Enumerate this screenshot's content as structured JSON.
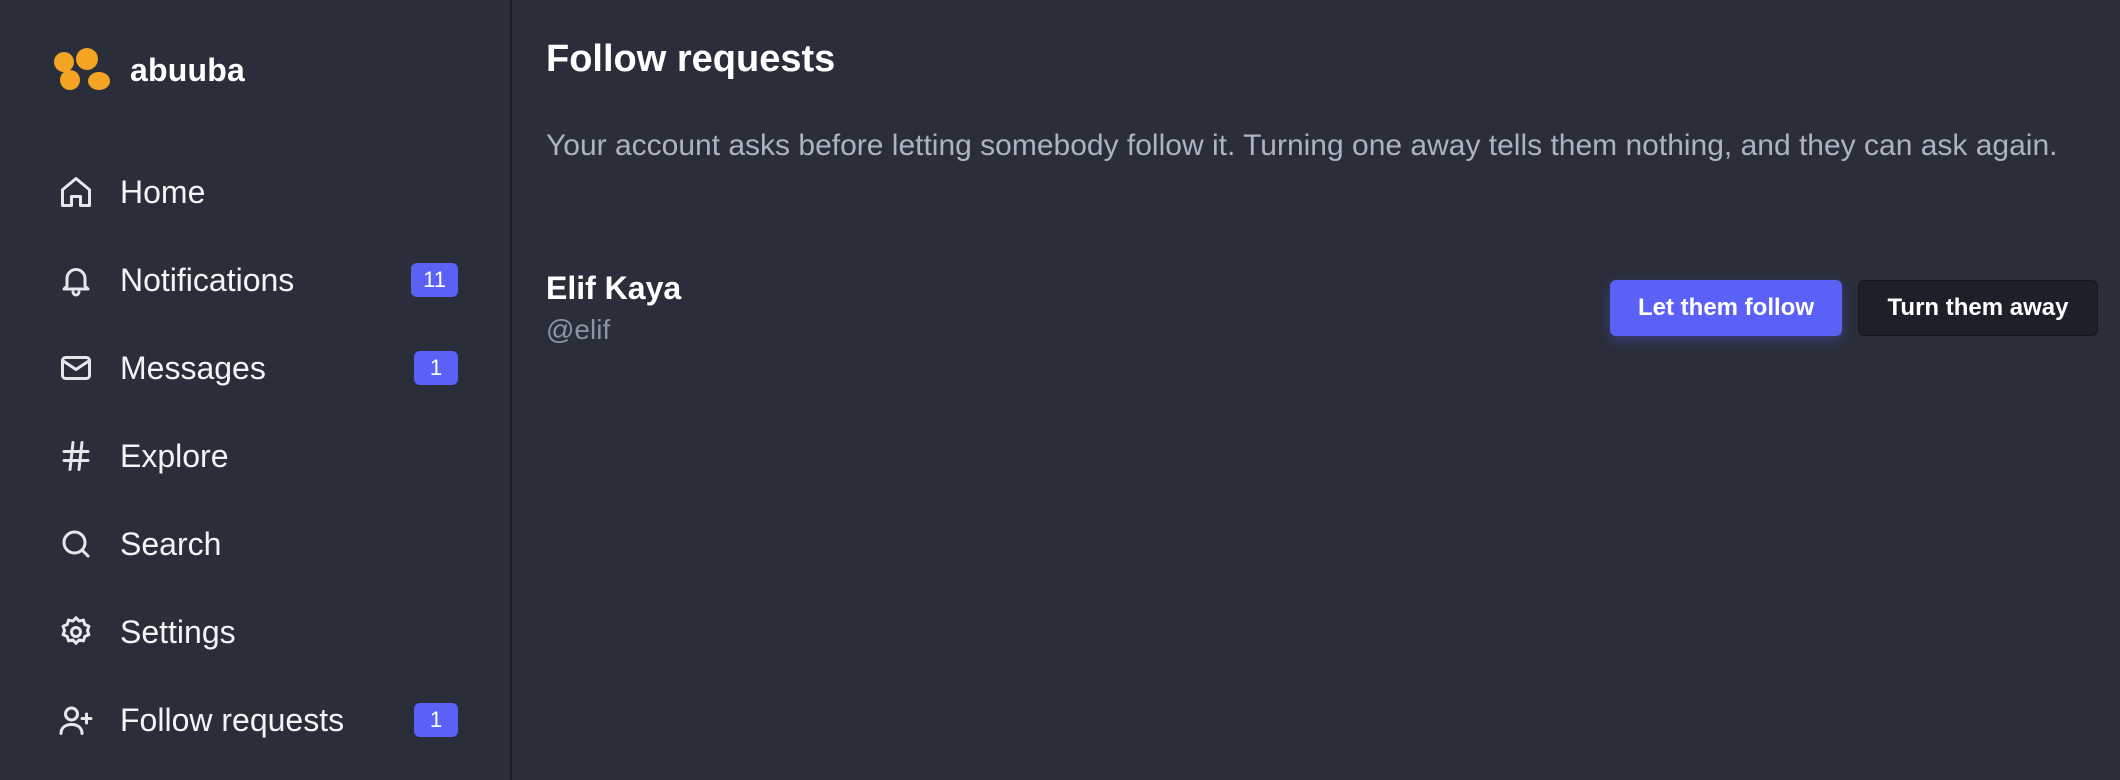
{
  "brand": {
    "name": "abuuba",
    "color": "#f5a524"
  },
  "nav": {
    "items": [
      {
        "label": "Home",
        "icon": "home-icon",
        "badge": null
      },
      {
        "label": "Notifications",
        "icon": "bell-icon",
        "badge": "11"
      },
      {
        "label": "Messages",
        "icon": "mail-icon",
        "badge": "1"
      },
      {
        "label": "Explore",
        "icon": "hash-icon",
        "badge": null
      },
      {
        "label": "Search",
        "icon": "search-icon",
        "badge": null
      },
      {
        "label": "Settings",
        "icon": "gear-icon",
        "badge": null
      },
      {
        "label": "Follow requests",
        "icon": "user-plus-icon",
        "badge": "1"
      }
    ]
  },
  "main": {
    "title": "Follow requests",
    "description": "Your account asks before letting somebody follow it. Turning one away tells them nothing, and they can ask again.",
    "requests": [
      {
        "name": "Elif Kaya",
        "handle": "@elif",
        "accept_label": "Let them follow",
        "reject_label": "Turn them away"
      }
    ]
  },
  "colors": {
    "background": "#2a2e3a",
    "accent": "#5b61f6",
    "muted_text": "#aeb3c2"
  }
}
